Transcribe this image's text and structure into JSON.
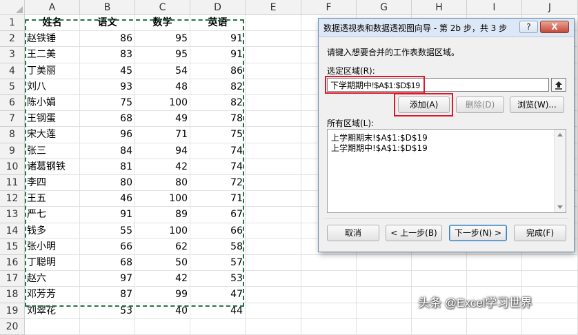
{
  "columns": [
    "A",
    "B",
    "C",
    "D",
    "E",
    "F",
    "G",
    "H",
    "I",
    "J"
  ],
  "table": {
    "headers": [
      "姓名",
      "语文",
      "数学",
      "英语"
    ],
    "rows": [
      [
        "赵铁锤",
        "86",
        "95",
        "91"
      ],
      [
        "王二美",
        "83",
        "95",
        "91"
      ],
      [
        "丁美丽",
        "45",
        "54",
        "86"
      ],
      [
        "刘八",
        "93",
        "48",
        "82"
      ],
      [
        "陈小娟",
        "75",
        "100",
        "82"
      ],
      [
        "王钢蛋",
        "68",
        "49",
        "78"
      ],
      [
        "宋大莲",
        "96",
        "71",
        "75"
      ],
      [
        "张三",
        "84",
        "94",
        "74"
      ],
      [
        "诸葛钢铁",
        "81",
        "42",
        "74"
      ],
      [
        "李四",
        "80",
        "80",
        "72"
      ],
      [
        "王五",
        "46",
        "100",
        "71"
      ],
      [
        "严七",
        "91",
        "89",
        "67"
      ],
      [
        "钱多",
        "55",
        "100",
        "66"
      ],
      [
        "张小明",
        "66",
        "62",
        "58"
      ],
      [
        "丁聪明",
        "68",
        "50",
        "57"
      ],
      [
        "赵六",
        "97",
        "42",
        "53"
      ],
      [
        "邓芳芳",
        "87",
        "99",
        "47"
      ],
      [
        "刘翠花",
        "53",
        "40",
        "44"
      ]
    ]
  },
  "dialog": {
    "title": "数据透视表和数据透视图向导 - 第 2b 步，共 3 步",
    "help_label": "?",
    "close_label": "X",
    "prompt": "请键入想要合并的工作表数据区域。",
    "range_label": "选定区域(R):",
    "range_value": "下学期期中!$A$1:$D$19",
    "add_label": "添加(A)",
    "delete_label": "删除(D)",
    "browse_label": "浏览(W)...",
    "all_ranges_label": "所有区域(L):",
    "all_ranges": [
      "上学期期末!$A$1:$D$19",
      "上学期期中!$A$1:$D$19"
    ],
    "cancel_label": "取消",
    "back_label": "< 上一步(B)",
    "next_label": "下一步(N) >",
    "finish_label": "完成(F)"
  },
  "watermark": "头条 @Excel学习世界",
  "colors": {
    "selection_marquee": "#217346",
    "highlight_red": "#e0162b"
  },
  "icons": [
    "collapse-dialog-icon",
    "scroll-up-arrow-icon",
    "scroll-down-arrow-icon"
  ]
}
